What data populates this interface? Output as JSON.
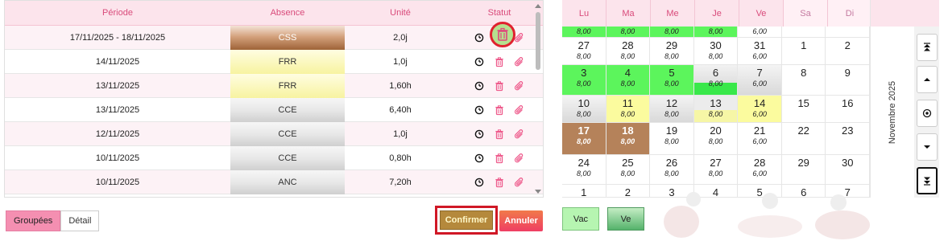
{
  "table": {
    "headers": {
      "periode": "Période",
      "absence": "Absence",
      "unite": "Unité",
      "statut": "Statut"
    },
    "rows": [
      {
        "periode": "17/11/2025 - 18/11/2025",
        "absence": "CSS",
        "unite": "2,0j",
        "kind": "css"
      },
      {
        "periode": "14/11/2025",
        "absence": "FRR",
        "unite": "1,0j",
        "kind": "frr"
      },
      {
        "periode": "13/11/2025",
        "absence": "FRR",
        "unite": "1,60h",
        "kind": "frr"
      },
      {
        "periode": "13/11/2025",
        "absence": "CCE",
        "unite": "6,40h",
        "kind": "cce"
      },
      {
        "periode": "12/11/2025",
        "absence": "CCE",
        "unite": "1,0j",
        "kind": "cce"
      },
      {
        "periode": "10/11/2025",
        "absence": "CCE",
        "unite": "0,80h",
        "kind": "cce"
      },
      {
        "periode": "10/11/2025",
        "absence": "ANC",
        "unite": "7,20h",
        "kind": "anc"
      }
    ]
  },
  "view_toggle": {
    "grouped": "Groupées",
    "detail": "Détail"
  },
  "actions": {
    "confirm": "Confirmer",
    "cancel": "Annuler"
  },
  "calendar": {
    "days": [
      "Lu",
      "Ma",
      "Me",
      "Je",
      "Ve",
      "Sa",
      "Di"
    ],
    "month_label": "Novembre 2025",
    "weeks": [
      [
        {
          "d": "",
          "h": "8,00",
          "c": "green"
        },
        {
          "d": "",
          "h": "8,00",
          "c": "green"
        },
        {
          "d": "",
          "h": "8,00",
          "c": "green"
        },
        {
          "d": "",
          "h": "8,00",
          "c": "green"
        },
        {
          "d": "",
          "h": "6,00",
          "c": "white"
        },
        {
          "d": "",
          "h": "",
          "c": "white"
        },
        {
          "d": "",
          "h": "",
          "c": "white"
        }
      ],
      [
        {
          "d": "27",
          "h": "8,00",
          "c": "white"
        },
        {
          "d": "28",
          "h": "8,00",
          "c": "white"
        },
        {
          "d": "29",
          "h": "8,00",
          "c": "white"
        },
        {
          "d": "30",
          "h": "8,00",
          "c": "white"
        },
        {
          "d": "31",
          "h": "6,00",
          "c": "white"
        },
        {
          "d": "1",
          "h": "",
          "c": "white"
        },
        {
          "d": "2",
          "h": "",
          "c": "white"
        }
      ],
      [
        {
          "d": "3",
          "h": "8,00",
          "c": "green"
        },
        {
          "d": "4",
          "h": "8,00",
          "c": "green"
        },
        {
          "d": "5",
          "h": "8,00",
          "c": "green"
        },
        {
          "d": "6",
          "h": "8,00",
          "c": "half"
        },
        {
          "d": "7",
          "h": "6,00",
          "c": "grey"
        },
        {
          "d": "8",
          "h": "",
          "c": "white"
        },
        {
          "d": "9",
          "h": "",
          "c": "white"
        }
      ],
      [
        {
          "d": "10",
          "h": "8,00",
          "c": "grey"
        },
        {
          "d": "11",
          "h": "8,00",
          "c": "yellow"
        },
        {
          "d": "12",
          "h": "8,00",
          "c": "grey"
        },
        {
          "d": "13",
          "h": "8,00",
          "c": "greyyellow"
        },
        {
          "d": "14",
          "h": "6,00",
          "c": "yellow"
        },
        {
          "d": "15",
          "h": "",
          "c": "white"
        },
        {
          "d": "16",
          "h": "",
          "c": "white"
        }
      ],
      [
        {
          "d": "17",
          "h": "8,00",
          "c": "brown"
        },
        {
          "d": "18",
          "h": "8,00",
          "c": "brown"
        },
        {
          "d": "19",
          "h": "8,00",
          "c": "white"
        },
        {
          "d": "20",
          "h": "8,00",
          "c": "white"
        },
        {
          "d": "21",
          "h": "6,00",
          "c": "white"
        },
        {
          "d": "22",
          "h": "",
          "c": "white"
        },
        {
          "d": "23",
          "h": "",
          "c": "white"
        }
      ],
      [
        {
          "d": "24",
          "h": "8,00",
          "c": "white"
        },
        {
          "d": "25",
          "h": "8,00",
          "c": "white"
        },
        {
          "d": "26",
          "h": "8,00",
          "c": "white"
        },
        {
          "d": "27",
          "h": "8,00",
          "c": "white"
        },
        {
          "d": "28",
          "h": "6,00",
          "c": "white"
        },
        {
          "d": "29",
          "h": "",
          "c": "white"
        },
        {
          "d": "30",
          "h": "",
          "c": "white"
        }
      ],
      [
        {
          "d": "1",
          "h": "",
          "c": "white"
        },
        {
          "d": "2",
          "h": "",
          "c": "white"
        },
        {
          "d": "3",
          "h": "",
          "c": "white"
        },
        {
          "d": "4",
          "h": "",
          "c": "white"
        },
        {
          "d": "5",
          "h": "",
          "c": "white"
        },
        {
          "d": "6",
          "h": "",
          "c": "white"
        },
        {
          "d": "7",
          "h": "",
          "c": "white"
        }
      ]
    ],
    "nav_icons": [
      "double-chevron-up-icon",
      "chevron-up-icon",
      "today-target-icon",
      "chevron-down-icon",
      "double-chevron-down-icon"
    ]
  },
  "legend": {
    "vac": "Vac",
    "ve": "Ve"
  },
  "colors": {
    "accent_pink": "#d94b7b",
    "header_pink": "#fce4ec",
    "highlight_red": "#e0212f",
    "confirm_bg": "#b5893c",
    "green_day": "#5cf55c",
    "brown_day": "#b5825a"
  }
}
